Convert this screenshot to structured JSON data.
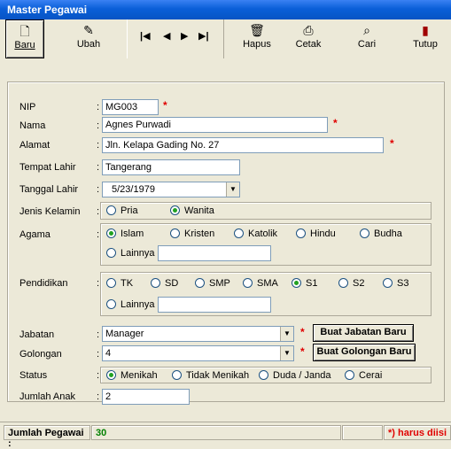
{
  "window": {
    "title": "Master Pegawai"
  },
  "toolbar": {
    "baru": "Baru",
    "ubah": "Ubah",
    "hapus": "Hapus",
    "cetak": "Cetak",
    "cari": "Cari",
    "tutup": "Tutup"
  },
  "form": {
    "nip": {
      "label": "NIP",
      "value": "MG003"
    },
    "nama": {
      "label": "Nama",
      "value": "Agnes Purwadi"
    },
    "alamat": {
      "label": "Alamat",
      "value": "Jln. Kelapa Gading No. 27"
    },
    "tempat_lahir": {
      "label": "Tempat Lahir",
      "value": "Tangerang"
    },
    "tanggal_lahir": {
      "label": "Tanggal Lahir",
      "value": "5/23/1979"
    },
    "jenis_kelamin": {
      "label": "Jenis Kelamin",
      "options": [
        "Pria",
        "Wanita"
      ],
      "selected": "Wanita"
    },
    "agama": {
      "label": "Agama",
      "options": [
        "Islam",
        "Kristen",
        "Katolik",
        "Hindu",
        "Budha"
      ],
      "lainnya": "Lainnya :",
      "selected": "Islam"
    },
    "pendidikan": {
      "label": "Pendidikan",
      "options": [
        "TK",
        "SD",
        "SMP",
        "SMA",
        "S1",
        "S2",
        "S3"
      ],
      "lainnya": "Lainnya :",
      "selected": "S1"
    },
    "jabatan": {
      "label": "Jabatan",
      "value": "Manager",
      "button": "Buat Jabatan Baru"
    },
    "golongan": {
      "label": "Golongan",
      "value": "4",
      "button": "Buat Golongan Baru"
    },
    "status": {
      "label": "Status",
      "options": [
        "Menikah",
        "Tidak Menikah",
        "Duda / Janda",
        "Cerai"
      ],
      "selected": "Menikah"
    },
    "jumlah_anak": {
      "label": "Jumlah Anak",
      "value": "2"
    },
    "colon": ":",
    "required_mark": "*"
  },
  "statusbar": {
    "label": "Jumlah Pegawai :",
    "count": "30",
    "note": "*) harus diisi",
    "count_color": "#008000",
    "note_color": "#e00000"
  }
}
